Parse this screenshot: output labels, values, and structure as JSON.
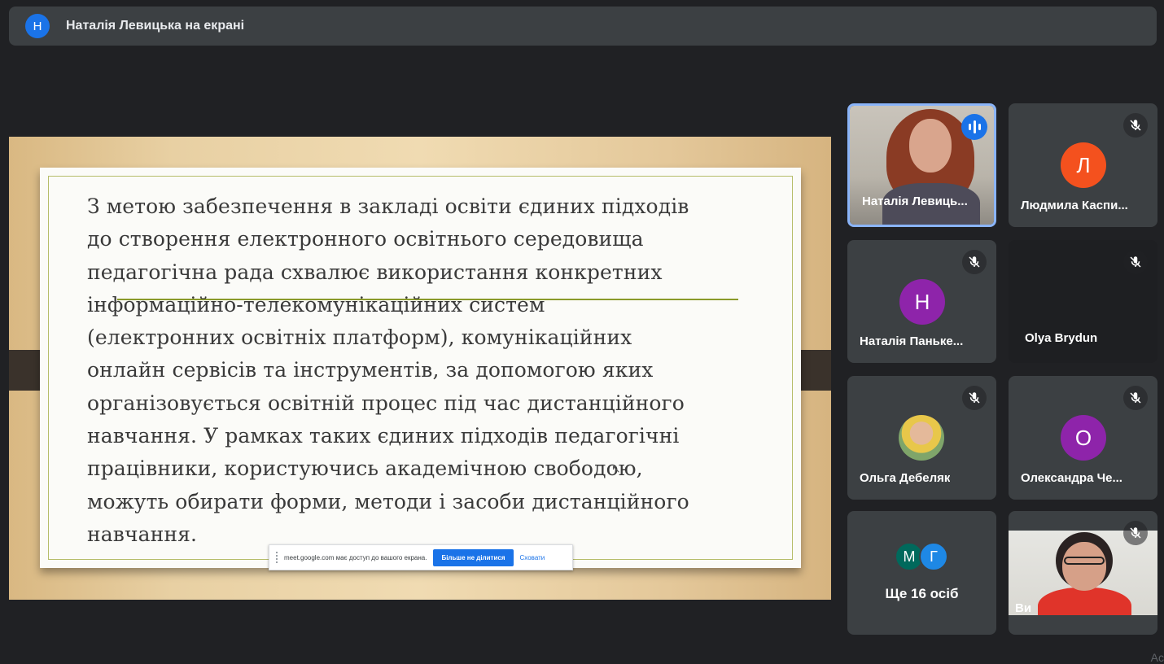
{
  "header": {
    "avatar_letter": "Н",
    "title": "Наталія Левицька на екрані"
  },
  "slide": {
    "lines": [
      "З метою забезпечення в закладі освіти єдиних підходів",
      "до створення електронного освітнього середовища",
      "педагогічна рада схвалює використання конкретних",
      "інформаційно-телекомунікаційних систем",
      "(електронних освітніх платформ), комунікаційних",
      "онлайн сервісів та інструментів, за допомогою яких",
      "організовується освітній процес під час дистанційного",
      "навчання. У рамках таких єдиних підходів педагогічні",
      "працівники, користуючись академічною свободою,",
      "можуть обирати форми, методи і засоби дистанційного",
      "навчання."
    ],
    "share_bar": {
      "message": "meet.google.com має доступ до вашого екрана.",
      "stop_label": "Більше не ділитися",
      "hide_label": "Сховати"
    }
  },
  "participants": [
    {
      "name": "Наталія Левиць...",
      "type": "video",
      "speaking": true
    },
    {
      "name": "Людмила Каспи...",
      "letter": "Л",
      "color": "#f4511e",
      "muted": true
    },
    {
      "name": "Наталія Паньке...",
      "letter": "Н",
      "color": "#8e24aa",
      "muted": true
    },
    {
      "name": "Olya Brydun",
      "muted": true
    },
    {
      "name": "Ольга Дебеляк",
      "type": "photo",
      "muted": true
    },
    {
      "name": "Олександра Че...",
      "letter": "О",
      "color": "#8e24aa",
      "muted": true
    },
    {
      "more_label": "Ще 16 осіб",
      "letters": [
        "М",
        "Г"
      ],
      "colors": [
        "#00695c",
        "#1e88e5"
      ]
    },
    {
      "name": "Ви",
      "type": "video",
      "muted": true
    }
  ],
  "corner_text": "Ac"
}
